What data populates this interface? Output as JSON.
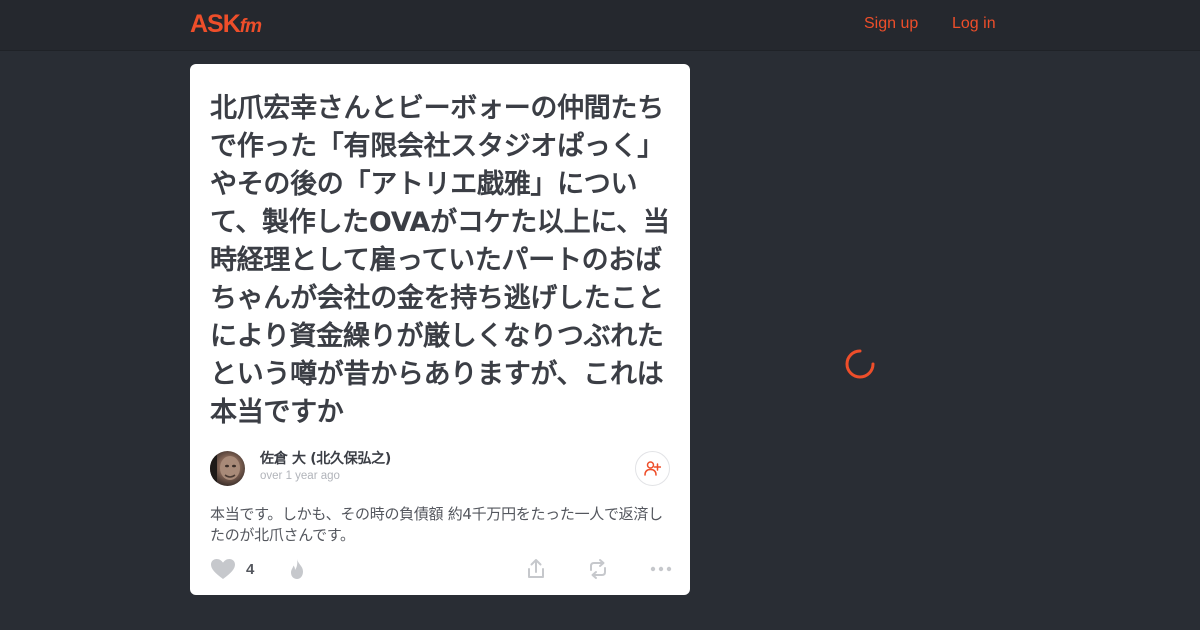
{
  "header": {
    "logo_main": "ASK",
    "logo_suffix": "fm",
    "signup_label": "Sign up",
    "login_label": "Log in",
    "accent_color": "#ee4e2a"
  },
  "post": {
    "question": "北爪宏幸さんとビーボォーの仲間たちで作った「有限会社スタジオぱっく」やその後の「アトリエ戯雅」について、製作したOVAがコケた以上に、当時経理として雇っていたパートのおばちゃんが会社の金を持ち逃げしたことにより資金繰りが厳しくなりつぶれたという噂が昔からありますが、これは本当ですか",
    "author": {
      "name": "佐倉 大 (北久保弘之)",
      "time": "over 1 year ago"
    },
    "answer": "本当です。しかも、その時の負債額 約4千万円をたった一人で返済したのが北爪さんです。",
    "likes": "4"
  },
  "icons": {
    "follow": "add-user-icon",
    "like": "heart-icon",
    "fire": "fire-icon",
    "share": "share-icon",
    "repost": "repost-icon",
    "more": "more-dots-icon",
    "loading": "loading-spinner"
  },
  "colors": {
    "page_background": "#292d34",
    "card_background": "#ffffff",
    "icon_gray": "#c6c8cc"
  }
}
